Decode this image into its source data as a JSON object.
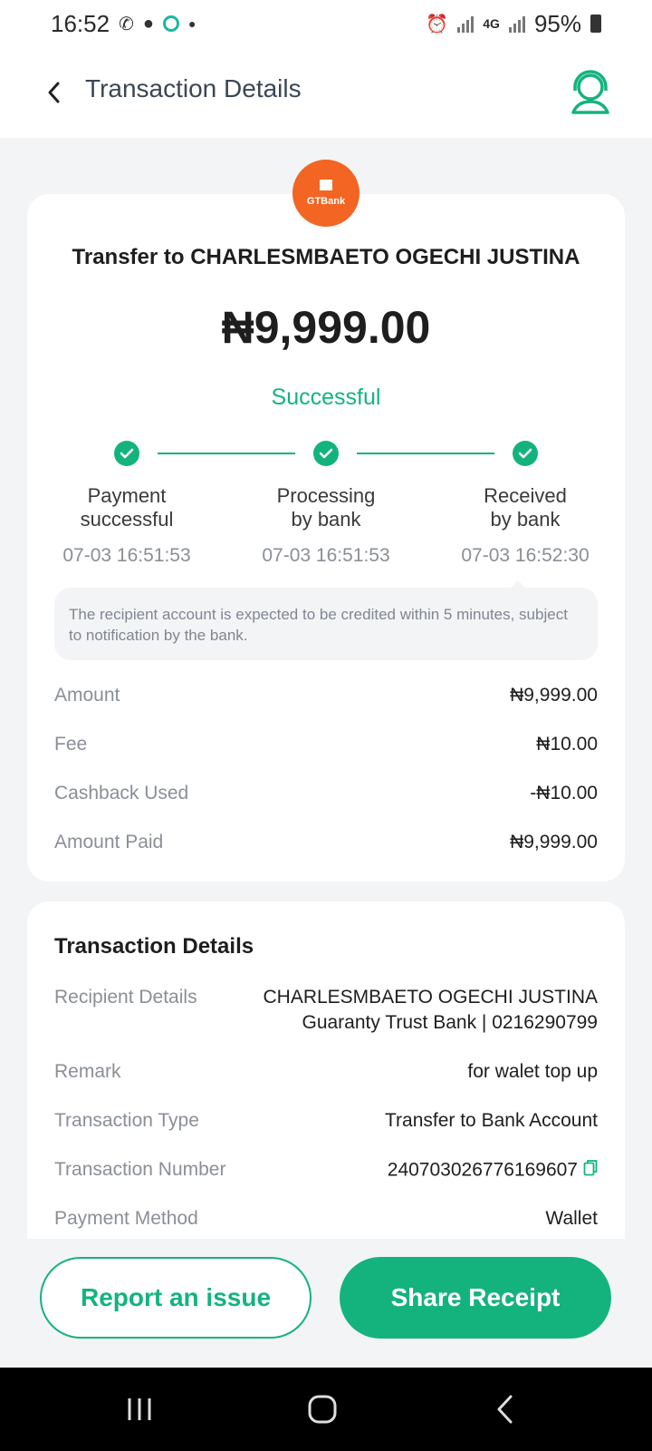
{
  "status_bar": {
    "time": "16:52",
    "battery": "95%",
    "network": "4G"
  },
  "header": {
    "title": "Transaction Details"
  },
  "bank": {
    "logo_text": "GTBank",
    "brand_color": "#f26522"
  },
  "transaction": {
    "title": "Transfer to CHARLESMBAETO OGECHI JUSTINA",
    "amount": "₦9,999.00",
    "status": "Successful"
  },
  "steps": [
    {
      "label": "Payment\nsuccessful",
      "time": "07-03 16:51:53"
    },
    {
      "label": "Processing\nby bank",
      "time": "07-03 16:51:53"
    },
    {
      "label": "Received\nby bank",
      "time": "07-03 16:52:30"
    }
  ],
  "notice": "The recipient account is expected to be credited within 5 minutes, subject to notification by the bank.",
  "summary": [
    {
      "label": "Amount",
      "value": "₦9,999.00"
    },
    {
      "label": "Fee",
      "value": "₦10.00"
    },
    {
      "label": "Cashback Used",
      "value": "-₦10.00"
    },
    {
      "label": "Amount Paid",
      "value": "₦9,999.00"
    }
  ],
  "details": {
    "title": "Transaction Details",
    "recipient_label": "Recipient Details",
    "recipient_name": "CHARLESMBAETO OGECHI JUSTINA",
    "recipient_bank": "Guaranty Trust Bank | 0216290799",
    "remark_label": "Remark",
    "remark_value": "for walet top up",
    "type_label": "Transaction Type",
    "type_value": "Transfer to Bank Account",
    "number_label": "Transaction Number",
    "number_value": "240703026776169607",
    "method_label": "Payment Method",
    "method_value": "Wallet"
  },
  "buttons": {
    "report": "Report an issue",
    "share": "Share Receipt"
  },
  "colors": {
    "accent": "#14b37d",
    "background": "#f3f4f6"
  }
}
